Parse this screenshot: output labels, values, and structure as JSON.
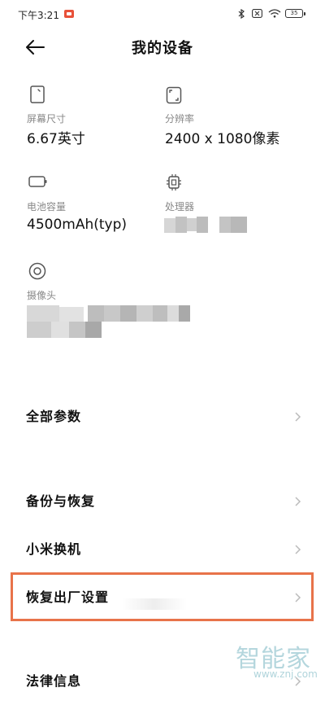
{
  "status_bar": {
    "time": "下午3:21",
    "battery": "35"
  },
  "header": {
    "title": "我的设备",
    "back_icon": "arrow-left-icon"
  },
  "specs": [
    {
      "icon": "phone-screen-icon",
      "label": "屏幕尺寸",
      "value": "6.67英寸"
    },
    {
      "icon": "resolution-icon",
      "label": "分辨率",
      "value": "2400 x 1080像素"
    },
    {
      "icon": "battery-icon",
      "label": "电池容量",
      "value": "4500mAh(typ)"
    },
    {
      "icon": "chip-icon",
      "label": "处理器",
      "value": ""
    },
    {
      "icon": "camera-icon",
      "label": "摄像头",
      "value": ""
    }
  ],
  "menu": [
    {
      "label": "全部参数"
    },
    {
      "label": "备份与恢复"
    },
    {
      "label": "小米换机"
    },
    {
      "label": "恢复出厂设置"
    },
    {
      "label": "法律信息"
    }
  ],
  "watermark": {
    "text": "智能家",
    "url": "www.znj.com"
  },
  "colors": {
    "highlight_border": "#e8734a",
    "watermark": "#a8d0d8"
  }
}
